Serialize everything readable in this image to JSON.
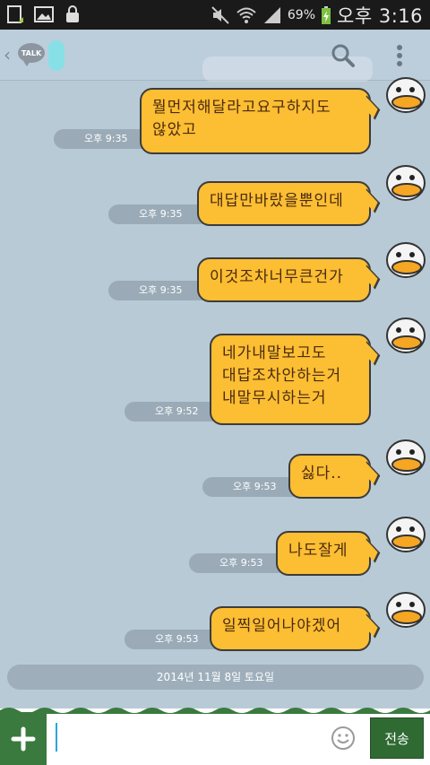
{
  "status_bar": {
    "battery": "69%",
    "time": "오후 3:16",
    "icons": [
      "download-icon",
      "gallery-icon",
      "lock-icon",
      "mute-icon",
      "wifi-icon",
      "signal-icon",
      "battery-charging-icon"
    ]
  },
  "header": {
    "logo": "TALK",
    "icons": [
      "search-icon",
      "menu-dots-icon"
    ]
  },
  "messages": [
    {
      "text": "뭘먼저해달라고요구하지도\n않았고",
      "time": "오후 9:35"
    },
    {
      "text": "대답만바랐을뿐인데",
      "time": "오후 9:35"
    },
    {
      "text": "이것조차너무큰건가",
      "time": "오후 9:35"
    },
    {
      "text": "네가내말보고도\n대답조차안하는거\n내말무시하는거",
      "time": "오후 9:52"
    },
    {
      "text": "싫다..",
      "time": "오후 9:53"
    },
    {
      "text": "나도잘게",
      "time": "오후 9:53"
    },
    {
      "text": "일찍일어나야겠어",
      "time": "오후 9:53"
    }
  ],
  "date_divider": "2014년 11월 8일 토요일",
  "input": {
    "value": "",
    "send_label": "전송"
  },
  "colors": {
    "background": "#b8cad6",
    "bubble": "#fcbe32",
    "send_button": "#2f6a33"
  }
}
